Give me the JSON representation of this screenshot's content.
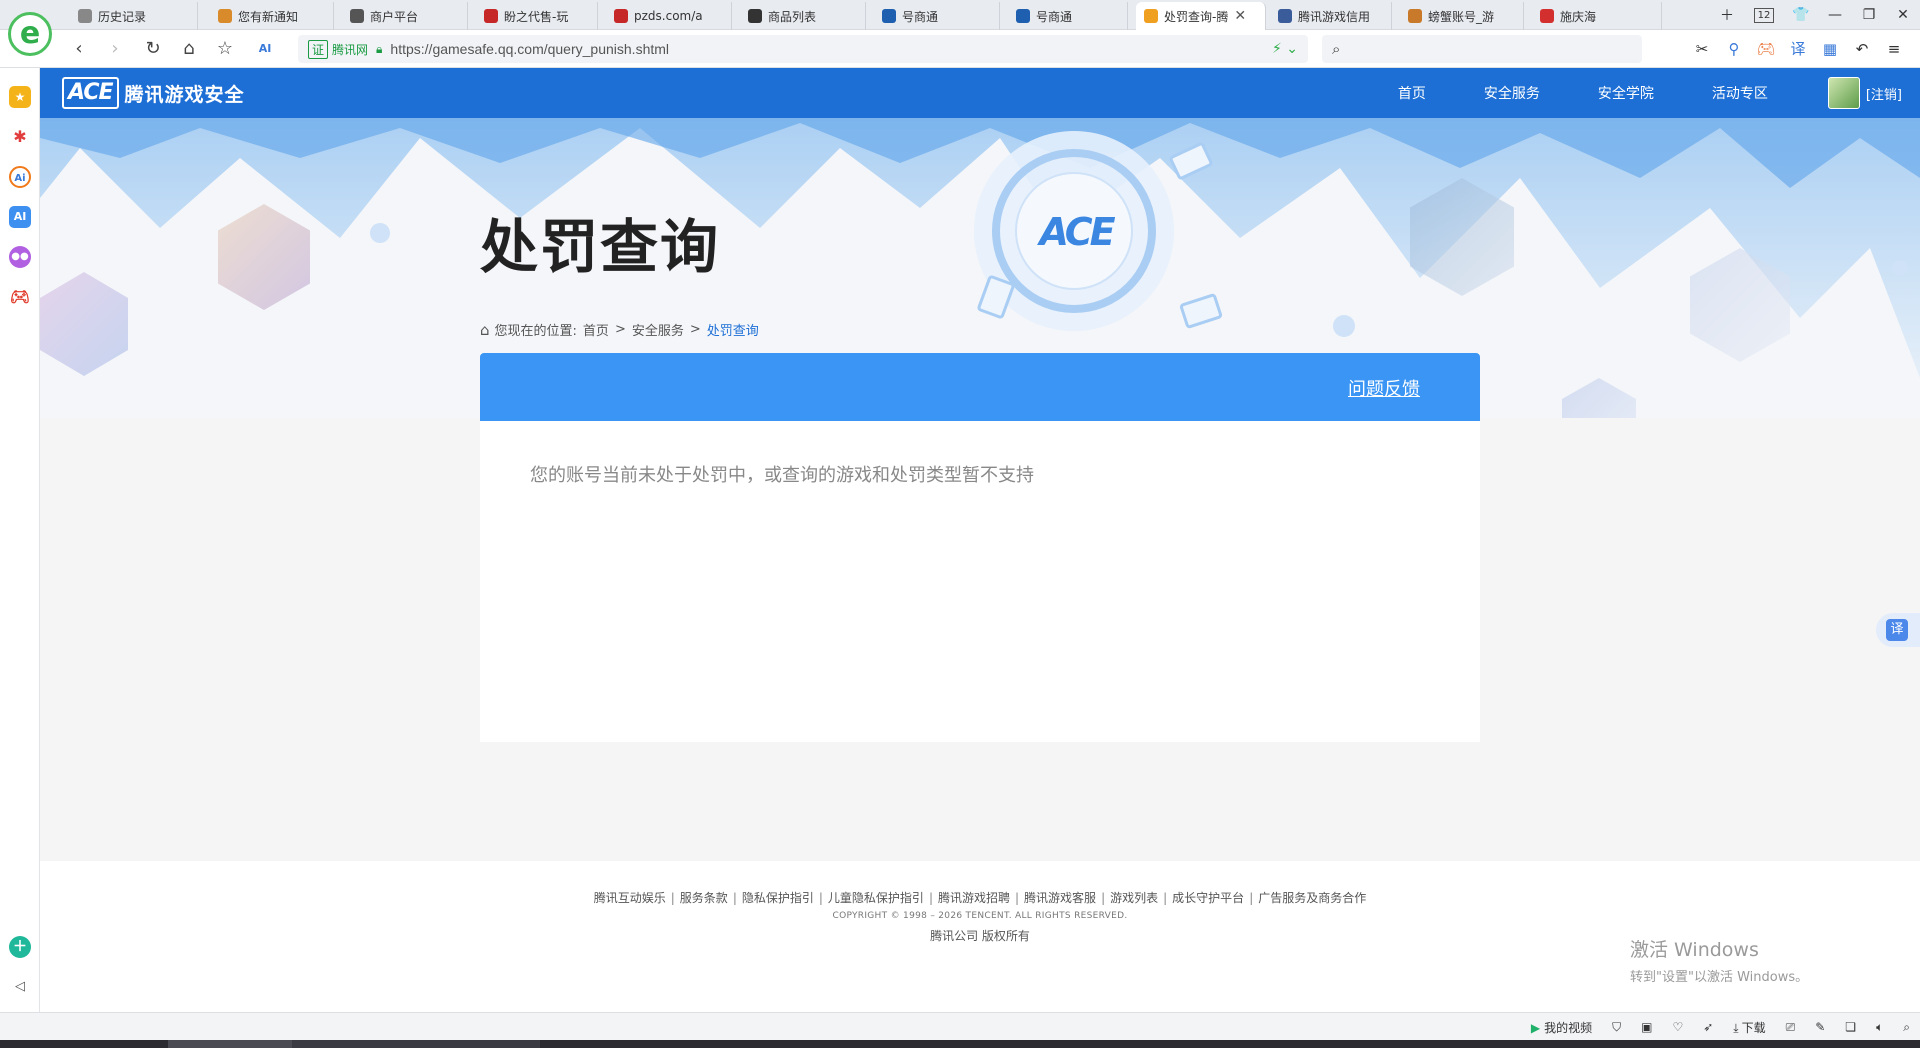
{
  "browser": {
    "tabs": [
      {
        "label": "历史记录",
        "color": "#888888"
      },
      {
        "label": "您有新通知",
        "color": "#d98a2b"
      },
      {
        "label": "商户平台",
        "color": "#555555"
      },
      {
        "label": "盼之代售-玩",
        "color": "#c62828"
      },
      {
        "label": "pzds.com/a",
        "color": "#c62828"
      },
      {
        "label": "商品列表",
        "color": "#333333"
      },
      {
        "label": "号商通",
        "color": "#1e5fb0"
      },
      {
        "label": "号商通",
        "color": "#1e5fb0"
      },
      {
        "label": "处罚查询-腾",
        "color": "#f0a020"
      },
      {
        "label": "腾讯游戏信用",
        "color": "#3a5c9a"
      },
      {
        "label": "螃蟹账号_游",
        "color": "#c87a2a"
      },
      {
        "label": "施庆海",
        "color": "#d32f2f"
      }
    ],
    "active_tab": 8,
    "tab_count": "12",
    "address": {
      "site_label": "腾讯网",
      "url": "https://gamesafe.qq.com/query_punish.shtml"
    }
  },
  "site": {
    "logo_ace": "ACE",
    "logo_name": "腾讯游戏安全",
    "nav": [
      "首页",
      "安全服务",
      "安全学院",
      "活动专区"
    ],
    "logout": "[注销]"
  },
  "page": {
    "title": "处罚查询",
    "breadcrumb": {
      "prefix": "您现在的位置:",
      "items": [
        "首页",
        "安全服务"
      ],
      "current": "处罚查询"
    },
    "feedback": "问题反馈",
    "message": "您的账号当前未处于处罚中，或查询的游戏和处罚类型暂不支持"
  },
  "footer": {
    "links": [
      "腾讯互动娱乐",
      "服务条款",
      "隐私保护指引",
      "儿童隐私保护指引",
      "腾讯游戏招聘",
      "腾讯游戏客服",
      "游戏列表",
      "成长守护平台",
      "广告服务及商务合作"
    ],
    "copyright": "COPYRIGHT © 1998 – 2026 TENCENT. ALL RIGHTS RESERVED.",
    "rights": "腾讯公司 版权所有"
  },
  "watermark": {
    "line1": "激活 Windows",
    "line2": "转到\"设置\"以激活 Windows。"
  },
  "translate": "译",
  "statusbar": {
    "my_video": "我的视频",
    "download": "下载"
  }
}
